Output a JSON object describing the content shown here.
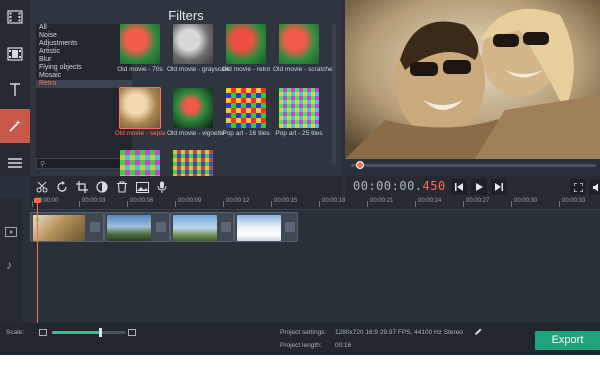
{
  "colors": {
    "accent": "#ff6a55",
    "export_bg": "#1fa37d",
    "active_tool": "#c8584a",
    "app_bg": "#2b313a"
  },
  "rail": {
    "items": [
      {
        "icon": "film-import-icon"
      },
      {
        "icon": "film-strip-icon"
      },
      {
        "icon": "text-icon"
      },
      {
        "icon": "magic-wand-icon",
        "active": true
      },
      {
        "icon": "menu-icon"
      }
    ]
  },
  "filters": {
    "title": "Filters",
    "categories": [
      "All",
      "Noise",
      "Adjustments",
      "Artistic",
      "Blur",
      "Flying objects",
      "Mosaic",
      "Retro"
    ],
    "selected_category": "Retro",
    "thumbnails": [
      {
        "label": "Old movie - 70s"
      },
      {
        "label": "Old movie - grayscale"
      },
      {
        "label": "Old movie - retro"
      },
      {
        "label": "Old movie - scratches"
      },
      {
        "label": "Old movie - sepia",
        "selected": true
      },
      {
        "label": "Old movie - vignette"
      },
      {
        "label": "Pop art - 16 tiles"
      },
      {
        "label": "Pop art - 25 tiles"
      }
    ]
  },
  "toolbar": {
    "tools": [
      "scissors-icon",
      "rotate-icon",
      "crop-icon",
      "color-adjust-icon",
      "trash-icon",
      "image-icon",
      "microphone-icon"
    ]
  },
  "player": {
    "time_main": "00:00:00.",
    "time_ms": "450",
    "controls": [
      "previous-icon",
      "play-icon",
      "next-icon"
    ],
    "progress": 0.02
  },
  "timeline": {
    "ticks": [
      "00:00:00",
      "00:00:03",
      "00:00:06",
      "00:00:09",
      "00:00:12",
      "00:00:15",
      "00:00:18",
      "00:00:21",
      "00:00:24",
      "00:00:27",
      "00:00:30",
      "00:00:33"
    ],
    "clips": 4
  },
  "status": {
    "scale_label": "Scale:",
    "settings_label": "Project settings:",
    "settings_value": "1280x720 16:9 29.97 FPS, 44100 Hz Stereo",
    "length_label": "Project length:",
    "length_value": "00:16",
    "export_label": "Export",
    "scale_value": 0.65
  }
}
